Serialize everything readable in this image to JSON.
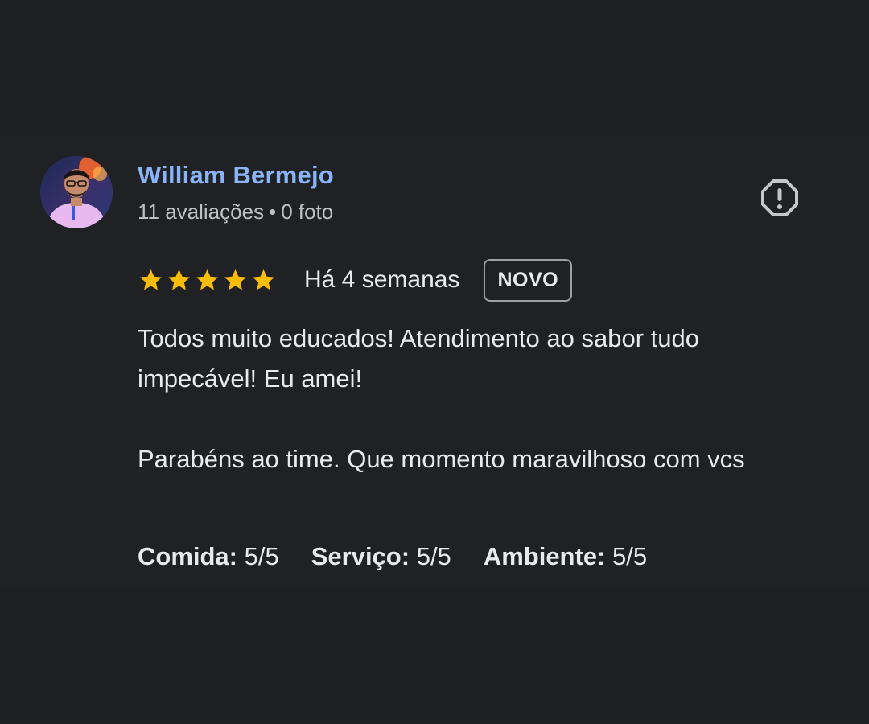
{
  "review": {
    "author": {
      "name": "William Bermejo",
      "reviews_count": "11 avaliações",
      "separator": "•",
      "photos_count": "0 foto"
    },
    "rating": {
      "stars": 5,
      "max_stars": 5,
      "star_color": "#fbbc04",
      "time_ago": "Há 4 semanas",
      "badge": "NOVO"
    },
    "text": {
      "paragraph1": "Todos muito educados! Atendimento ao sabor tudo impecável! Eu amei!",
      "paragraph2": "Parabéns ao time. Que momento maravilhoso com vcs"
    },
    "sub_ratings": [
      {
        "label": "Comida:",
        "value": "5/5"
      },
      {
        "label": "Serviço:",
        "value": "5/5"
      },
      {
        "label": "Ambiente:",
        "value": "5/5"
      }
    ],
    "report_icon": "report-icon"
  },
  "colors": {
    "background": "#1f2023",
    "author_name": "#8ab4f8",
    "text": "#e8eaed",
    "muted": "#bdc1c6"
  }
}
